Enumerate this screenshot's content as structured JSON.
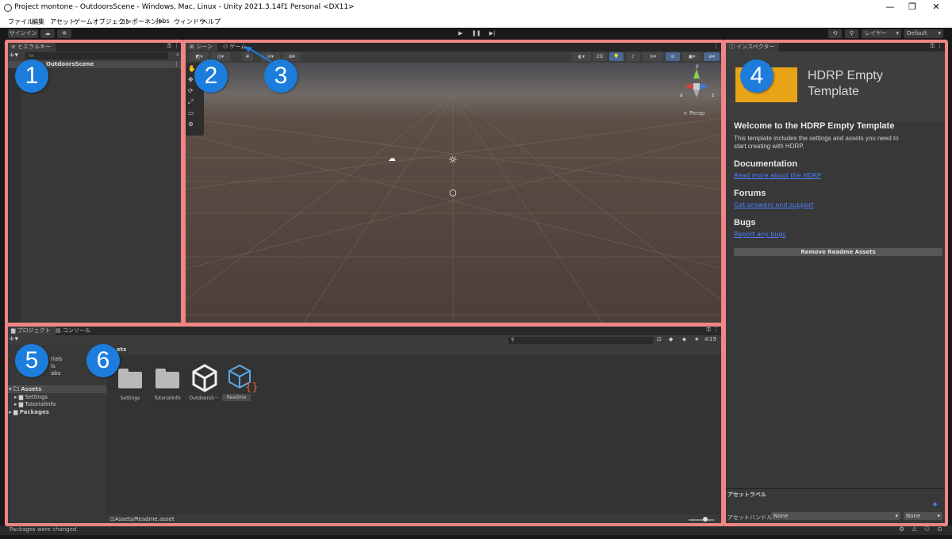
{
  "window": {
    "title": "Project montone - OutdoorsScene - Windows, Mac, Linux - Unity 2021.3.14f1 Personal <DX11>",
    "minimize": "—",
    "maximize": "❐",
    "close": "✕"
  },
  "menu": [
    "ファイル",
    "編集",
    "アセット",
    "ゲームオブジェクト",
    "コンポーネント",
    "Jobs",
    "ウィンドウ",
    "ヘルプ"
  ],
  "toolbar": {
    "signin_label": "サインイン",
    "layers_label": "レイヤー",
    "layout_label": "Default"
  },
  "hierarchy": {
    "tab_label": "ヒエラルキー",
    "search_placeholder": "All",
    "scene_name": "OutdoorsScene"
  },
  "scene": {
    "tab_scene": "シーン",
    "tab_game": "ゲーム",
    "toggle_2d": "2D",
    "persp_label": "< Persp",
    "gizmo_y": "y",
    "gizmo_x": "x",
    "gizmo_z": "z"
  },
  "inspector": {
    "tab_label": "インスペクター",
    "title_line1": "HDRP Empty",
    "title_line2": "Template",
    "welcome_heading": "Welcome to the HDRP Empty Template",
    "welcome_line1": "This template includes the settings and assets you need to",
    "welcome_line2": "start creating with HDRP.",
    "doc_heading": "Documentation",
    "doc_link": "Read more about the HDRP",
    "forums_heading": "Forums",
    "forums_link": "Get answers and support",
    "bugs_heading": "Bugs",
    "bugs_link": "Report any bugs",
    "remove_button": "Remove Readme Assets",
    "asset_labels": "アセットラベル",
    "asset_bundle": "アセットバンドル",
    "bundle_value": "None",
    "variant_value": "None"
  },
  "project": {
    "tab_project": "プロジェクト",
    "tab_console": "コンソール",
    "favorites_partial": [
      "rials",
      "ls",
      "abs"
    ],
    "tree": {
      "assets": "Assets",
      "settings": "Settings",
      "tutorialinfo": "TutorialInfo",
      "packages": "Packages"
    },
    "breadcrumb": "ets",
    "hidden_count": "19",
    "items": [
      "Settings",
      "TutorialInfo",
      "OutdoorsS···",
      "Readme"
    ],
    "selected_path": "Assets/Readme.asset"
  },
  "status": {
    "message": "Packages were changed."
  },
  "badges": [
    "1",
    "2",
    "3",
    "4",
    "5",
    "6"
  ],
  "colors": {
    "highlight_border": "#f08585",
    "badge": "#1d7ddd",
    "link": "#4c7eff",
    "template_logo": "#e8a317"
  }
}
